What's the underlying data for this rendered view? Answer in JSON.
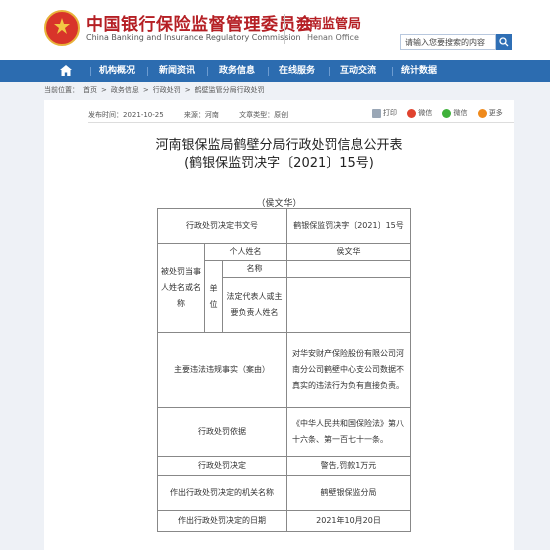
{
  "header": {
    "org_cn": "中国银行保险监督管理委员会",
    "org_en": "China Banking and Insurance Regulatory Commission",
    "office_cn": "河南监管局",
    "office_en": "Henan Office",
    "search_placeholder": "请输入您要搜索的内容",
    "brand_red": "#b51f24",
    "nav_blue": "#2c6cb0"
  },
  "nav": {
    "home_icon": "home-icon",
    "items": [
      "机构概况",
      "新闻资讯",
      "政务信息",
      "在线服务",
      "互动交流",
      "统计数据"
    ]
  },
  "breadcrumb": {
    "items": [
      "当前位置：",
      "首页",
      ">",
      "政务信息",
      ">",
      "行政处罚",
      ">",
      "鹤壁监管分局行政处罚"
    ]
  },
  "article": {
    "published": "发布时间：2021-10-25",
    "source": "来源：河南",
    "type": "文章类型：原创",
    "share": {
      "print": "打印",
      "weibo": "微信",
      "wechat": "微信",
      "more": "更多"
    },
    "title_line1": "河南银保监局鹤壁分局行政处罚信息公开表",
    "title_line2": "(鹤银保监罚决字〔2021〕15号)",
    "person": "（侯文华）"
  },
  "table": {
    "doc_no_label": "行政处罚决定书文号",
    "doc_no_value": "鹤银保监罚决字〔2021〕15号",
    "party_label": "被处罚当事人姓名或名称",
    "individual_label": "个人姓名",
    "individual_value": "侯文华",
    "unit_label": "单位",
    "unit_name_label": "名称",
    "unit_name_value": "",
    "rep_label": "法定代表人或主要负责人姓名",
    "rep_value": "",
    "facts_label": "主要违法违规事实（案由）",
    "facts_value": "对华安财产保险股份有限公司河南分公司鹤壁中心支公司数据不真实的违法行为负有直接负责。",
    "basis_label": "行政处罚依据",
    "basis_value": "《中华人民共和国保险法》第八十六条、第一百七十一条。",
    "decision_label": "行政处罚决定",
    "decision_value": "警告,罚款1万元",
    "authority_label": "作出行政处罚决定的机关名称",
    "authority_value": "鹤壁银保监分局",
    "date_label": "作出行政处罚决定的日期",
    "date_value": "2021年10月20日"
  }
}
